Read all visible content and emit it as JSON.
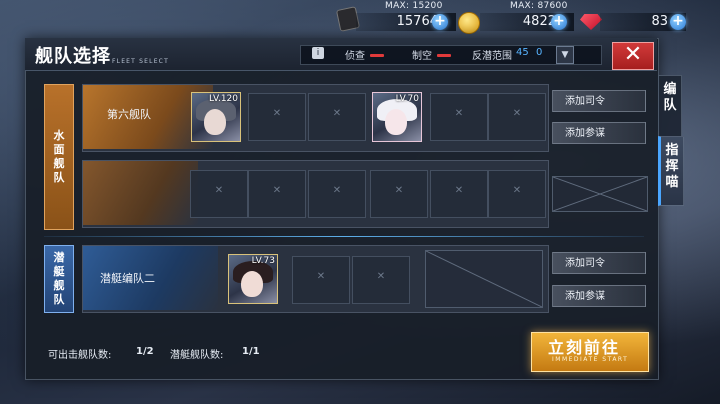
{
  "resources": {
    "oil": {
      "max_label": "MAX: 15200",
      "value": "15764"
    },
    "gold": {
      "max_label": "MAX: 87600",
      "value": "4822"
    },
    "gems": {
      "value": "83"
    }
  },
  "header": {
    "title": "舰队选择",
    "subtitle": "FLEET SELECT",
    "info_icon": "i",
    "stats": {
      "recon": "侦查",
      "air": "制空",
      "asw": "反潜范围",
      "asw_min": "45",
      "asw_max": "0"
    },
    "dropdown_icon": "▼",
    "close_icon": "✕"
  },
  "side_tabs": [
    {
      "label": "编队"
    },
    {
      "label": "指挥喵"
    }
  ],
  "surface": {
    "section_label": "水面舰队",
    "fleet1": {
      "name": "第六舰队",
      "ships": [
        {
          "level": "LV.120"
        },
        {
          "level": "LV.70"
        }
      ],
      "buttons": {
        "commander": "添加司令",
        "advisor": "添加参谋"
      }
    }
  },
  "submarine": {
    "section_label": "潜艇舰队",
    "fleet": {
      "name": "潜艇编队二",
      "ships": [
        {
          "level": "LV.73"
        }
      ],
      "buttons": {
        "commander": "添加司令",
        "advisor": "添加参谋"
      }
    }
  },
  "footer": {
    "sortie_label": "可出击舰队数:",
    "sortie_value": "1/2",
    "sub_label": "潜艇舰队数:",
    "sub_value": "1/1",
    "go_button": "立刻前往",
    "go_button_sub": "IMMEDIATE START"
  },
  "colors": {
    "accent_orange": "#c47a12",
    "accent_blue": "#4aa6ff",
    "close_red": "#d23a3a"
  }
}
